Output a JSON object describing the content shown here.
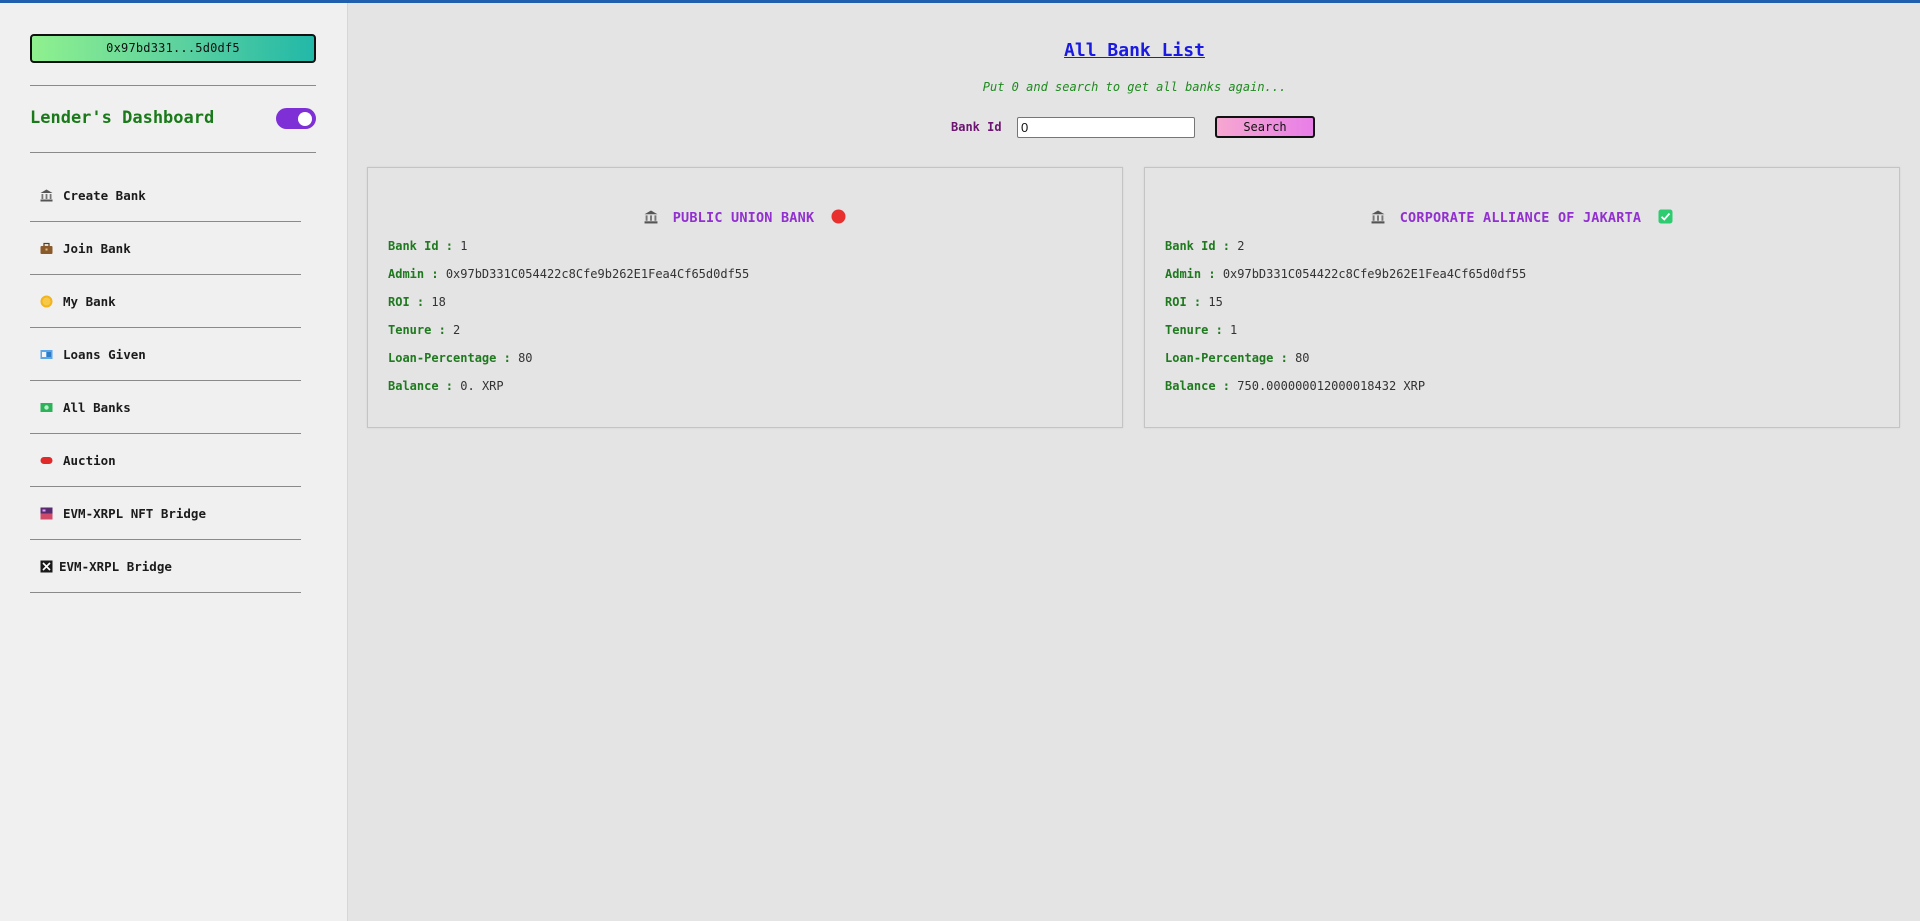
{
  "sidebar": {
    "wallet_address": "0x97bd331...5d0df5",
    "dashboard_title": "Lender's Dashboard",
    "menu": [
      {
        "label": "Create Bank",
        "icon": "bank-icon"
      },
      {
        "label": "Join Bank",
        "icon": "briefcase-icon"
      },
      {
        "label": "My Bank",
        "icon": "coin-icon"
      },
      {
        "label": "Loans Given",
        "icon": "money-icon"
      },
      {
        "label": "All Banks",
        "icon": "cash-icon"
      },
      {
        "label": "Auction",
        "icon": "red-tag-icon"
      },
      {
        "label": "EVM-XRPL NFT Bridge",
        "icon": "nft-icon"
      },
      {
        "label": "EVM-XRPL Bridge",
        "icon": "bridge-icon"
      }
    ]
  },
  "main": {
    "title": "All Bank List",
    "hint": "Put 0 and search to get all banks again...",
    "search": {
      "label": "Bank Id",
      "value": "0",
      "button": "Search"
    }
  },
  "labels": {
    "bank_id": "Bank Id :",
    "admin": "Admin :",
    "roi": "ROI :",
    "tenure": "Tenure :",
    "loan_percentage": "Loan-Percentage :",
    "balance": "Balance :"
  },
  "banks": [
    {
      "name": "PUBLIC UNION BANK",
      "status": "inactive",
      "bank_id": "1",
      "admin": "0x97bD331C054422c8Cfe9b262E1Fea4Cf65d0df55",
      "roi": "18",
      "tenure": "2",
      "loan_percentage": "80",
      "balance": "0. XRP"
    },
    {
      "name": "CORPORATE ALLIANCE OF JAKARTA",
      "status": "active",
      "bank_id": "2",
      "admin": "0x97bD331C054422c8Cfe9b262E1Fea4Cf65d0df55",
      "roi": "15",
      "tenure": "1",
      "loan_percentage": "80",
      "balance": "750.000000012000018432 XRP"
    }
  ],
  "colors": {
    "accent_purple": "#7e2fd6",
    "title_green": "#1a7a1a",
    "bank_name": "#9130cf",
    "status_red": "#e8312f",
    "status_green": "#2ecc71"
  }
}
